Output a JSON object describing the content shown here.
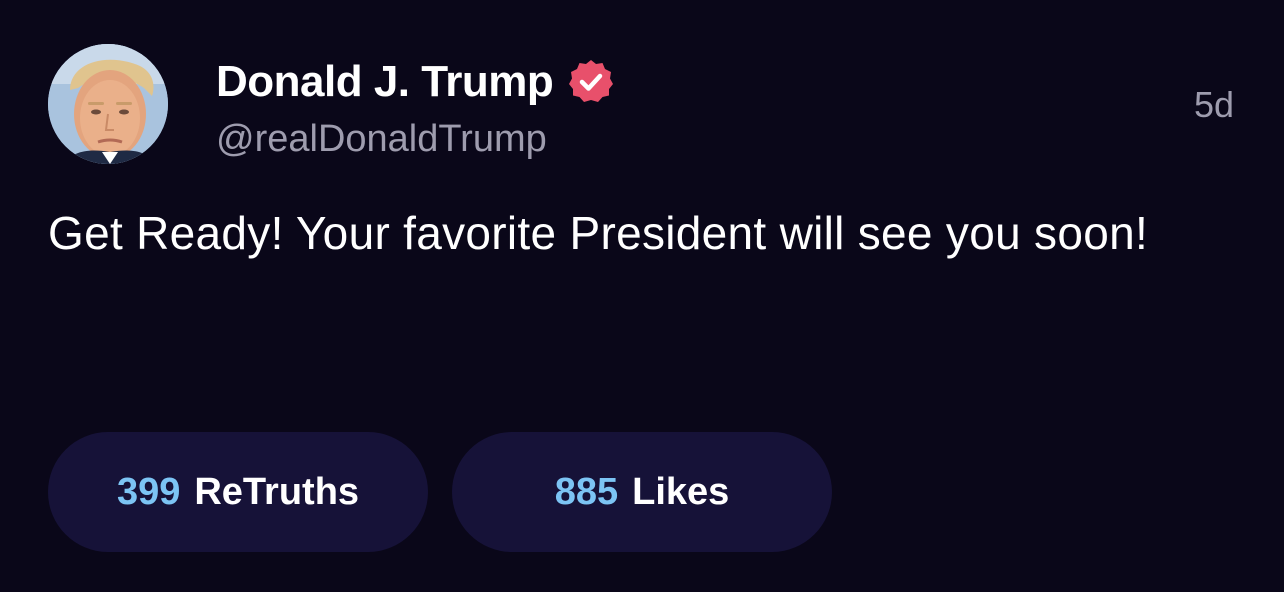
{
  "post": {
    "author": {
      "display_name": "Donald J. Trump",
      "handle": "@realDonaldTrump",
      "verified_icon": "verified-badge-icon",
      "avatar": "avatar-photo"
    },
    "timestamp": "5d",
    "body": "Get Ready! Your favorite President will see you soon!",
    "stats": {
      "retruths": {
        "count": "399",
        "label": "ReTruths"
      },
      "likes": {
        "count": "885",
        "label": "Likes"
      }
    }
  },
  "colors": {
    "background": "#0a0719",
    "pill_background": "#161238",
    "count_accent": "#7cc4f4",
    "muted_text": "#9e9cae",
    "verified_badge": "#e8506b"
  }
}
